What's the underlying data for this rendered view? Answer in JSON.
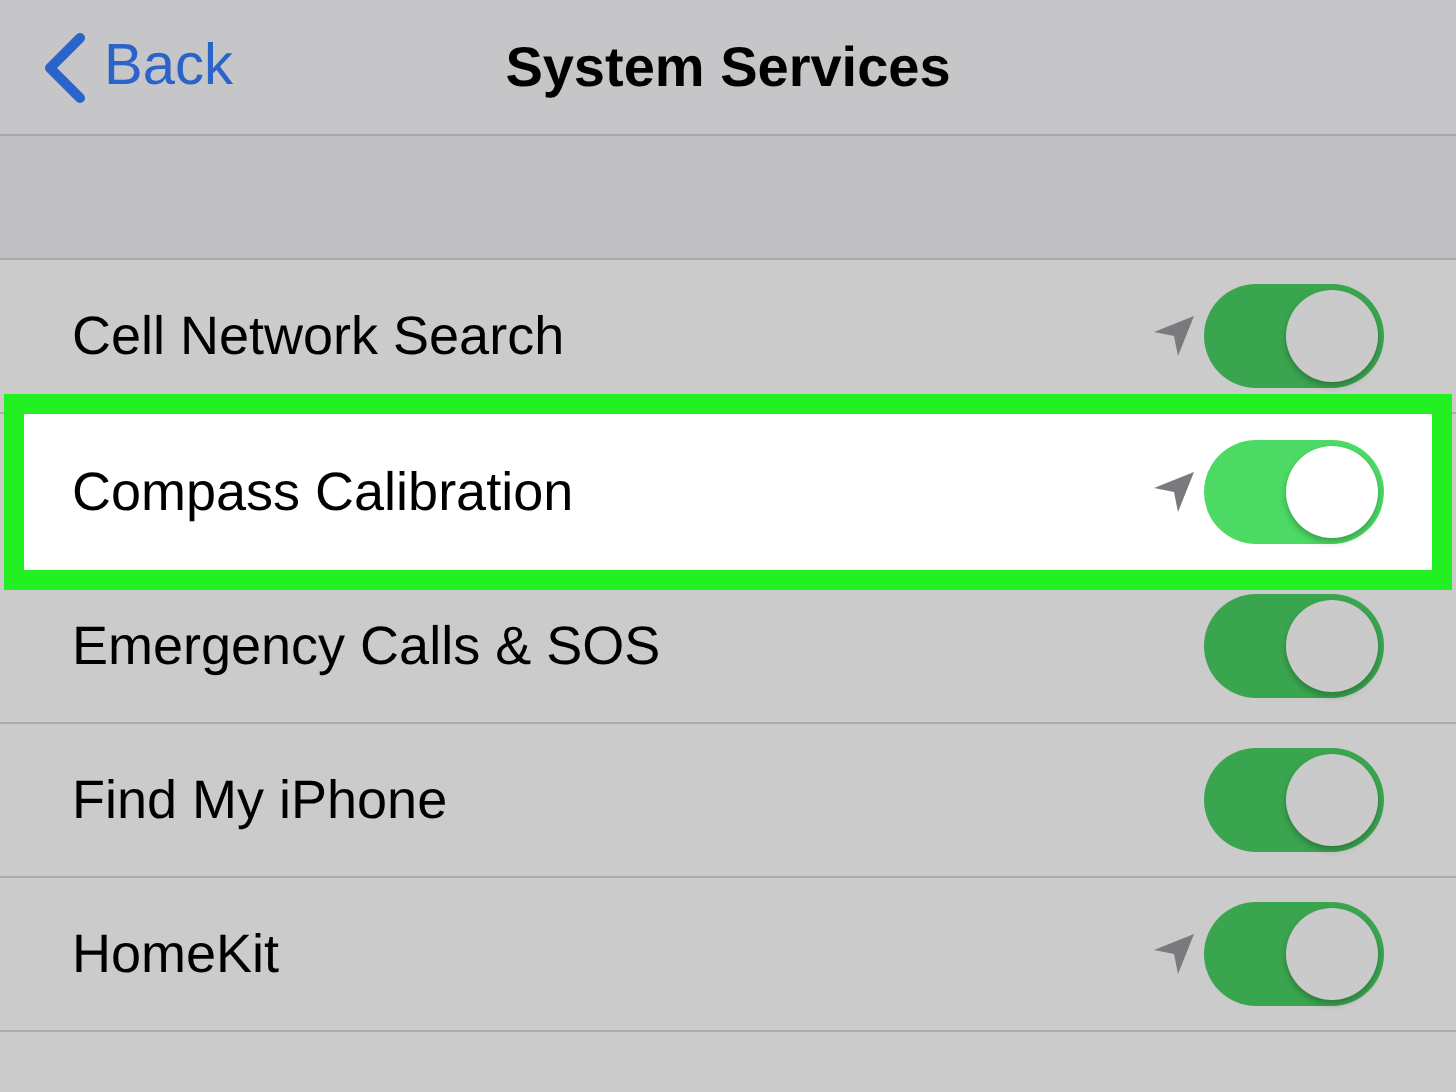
{
  "nav": {
    "back": "Back",
    "title": "System Services"
  },
  "items": [
    {
      "label": "Cell Network Search",
      "on": true,
      "location": true,
      "highlighted": false
    },
    {
      "label": "Compass Calibration",
      "on": true,
      "location": true,
      "highlighted": true
    },
    {
      "label": "Emergency Calls & SOS",
      "on": true,
      "location": false,
      "highlighted": false
    },
    {
      "label": "Find My iPhone",
      "on": true,
      "location": false,
      "highlighted": false
    },
    {
      "label": "HomeKit",
      "on": true,
      "location": true,
      "highlighted": false
    }
  ]
}
